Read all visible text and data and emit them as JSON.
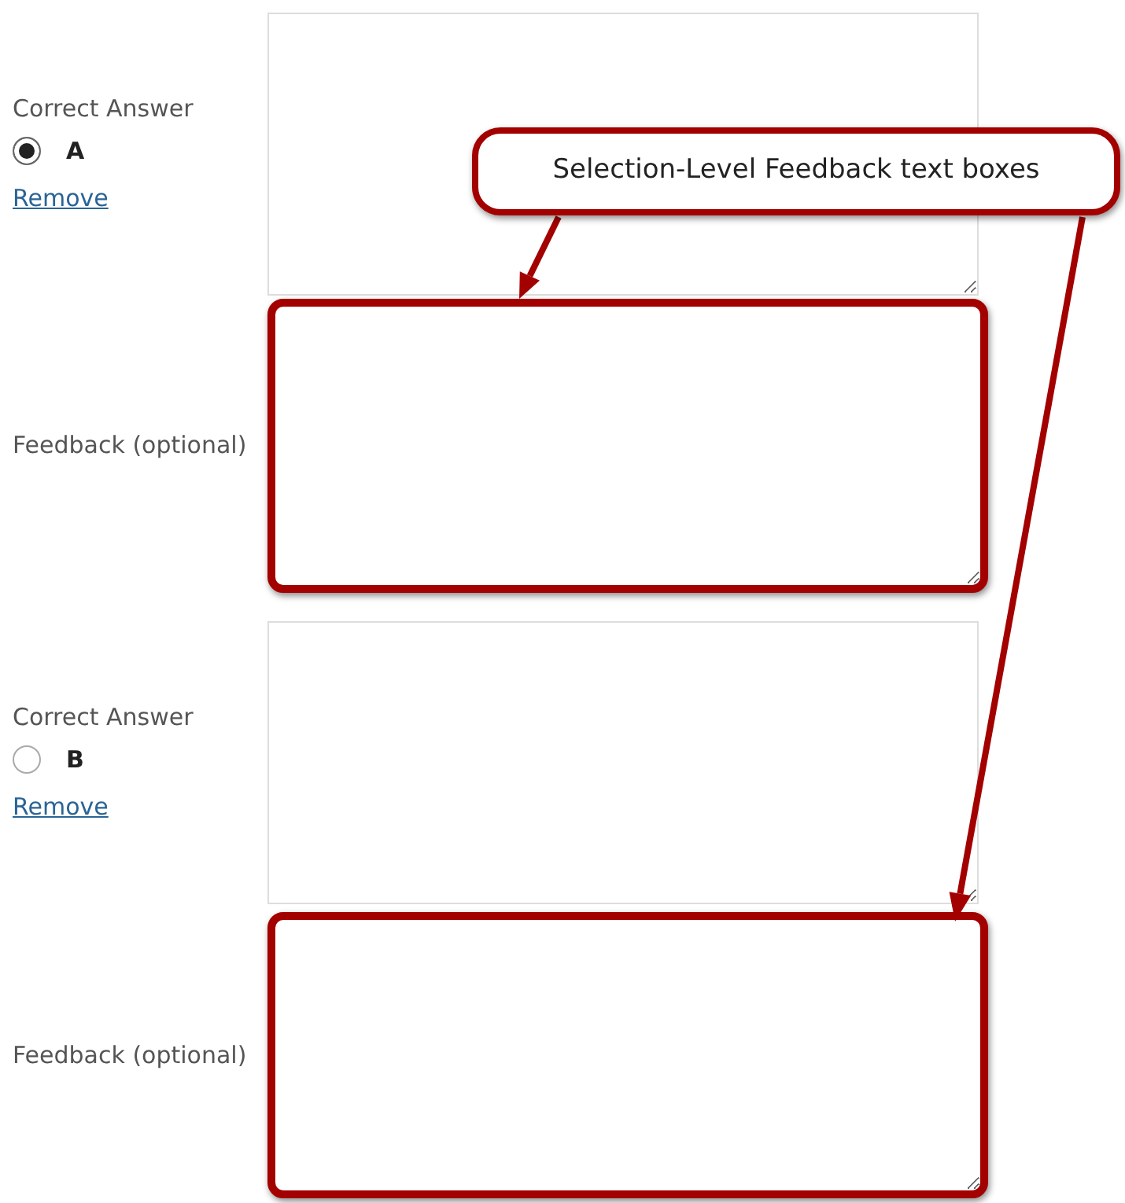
{
  "answers": [
    {
      "correct_answer_label": "Correct Answer",
      "letter": "A",
      "selected": true,
      "remove_link": "Remove",
      "feedback_label": "Feedback (optional)",
      "feedback_highlighted": true
    },
    {
      "correct_answer_label": "Correct Answer",
      "letter": "B",
      "selected": false,
      "remove_link": "Remove",
      "feedback_label": "Feedback (optional)",
      "feedback_highlighted": true
    }
  ],
  "callout": {
    "text": "Selection-Level Feedback text boxes"
  }
}
